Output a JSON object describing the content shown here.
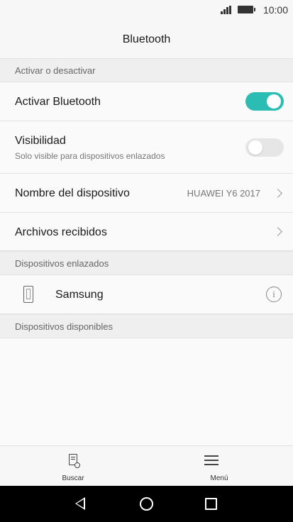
{
  "status_bar": {
    "time": "10:00",
    "icons": [
      "signal-icon",
      "battery-icon"
    ]
  },
  "header": {
    "title": "Bluetooth"
  },
  "sections": {
    "toggle_section": "Activar o desactivar",
    "paired_section": "Dispositivos enlazados",
    "available_section": "Dispositivos disponibles"
  },
  "settings": {
    "bluetooth": {
      "label": "Activar Bluetooth",
      "enabled": true
    },
    "visibility": {
      "label": "Visibilidad",
      "sublabel": "Solo visible para dispositivos enlazados",
      "enabled": false
    },
    "device_name": {
      "label": "Nombre del dispositivo",
      "value": "HUAWEI Y6 2017"
    },
    "received_files": {
      "label": "Archivos recibidos"
    }
  },
  "paired_devices": [
    {
      "name": "Samsung",
      "icon": "phone-icon"
    }
  ],
  "bottom_bar": {
    "search_label": "Buscar",
    "menu_label": "Menú"
  },
  "colors": {
    "accent": "#2bbcb4",
    "toggle_off": "#e6e6e6",
    "section_bg": "#efefef"
  }
}
